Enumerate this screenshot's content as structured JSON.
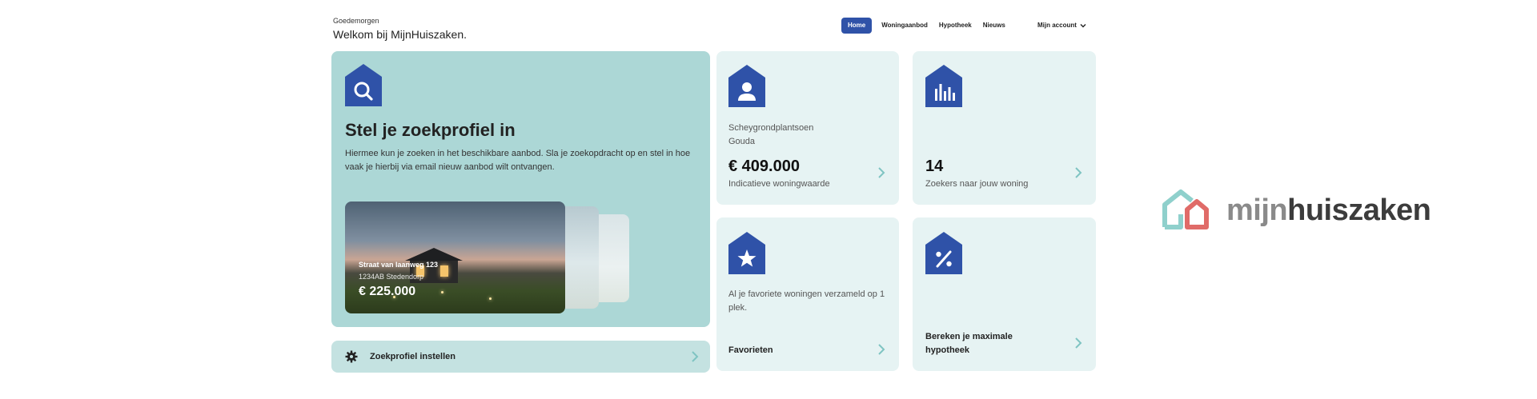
{
  "header": {
    "greeting_small": "Goedemorgen",
    "greeting_big": "Welkom bij MijnHuiszaken."
  },
  "nav": {
    "items": [
      {
        "label": "Home",
        "active": true
      },
      {
        "label": "Woningaanbod",
        "active": false
      },
      {
        "label": "Hypotheek",
        "active": false
      },
      {
        "label": "Nieuws",
        "active": false
      }
    ],
    "account_label": "Mijn account"
  },
  "hero": {
    "icon": "search-icon",
    "title": "Stel je zoekprofiel in",
    "description": "Hiermee kun je zoeken in het beschikbare aanbod. Sla je zoekopdracht op en stel in hoe vaak je hierbij via email nieuw aanbod wilt ontvangen.",
    "listing": {
      "street": "Straat van laanweg 123",
      "zip_city": "1234AB Stedendorp",
      "price": "€ 225.000"
    }
  },
  "profile_bar": {
    "icon": "gear-icon",
    "label": "Zoekprofiel instellen"
  },
  "cards": {
    "value": {
      "icon": "person-icon",
      "street": "Scheygrondplantsoen",
      "city": "Gouda",
      "amount": "€ 409.000",
      "caption": "Indicatieve woningwaarde"
    },
    "seekers": {
      "icon": "bar-chart-icon",
      "count": "14",
      "caption": "Zoekers naar jouw woning"
    },
    "favorites": {
      "icon": "star-icon",
      "description": "Al je favoriete woningen verzameld op 1 plek.",
      "label": "Favorieten"
    },
    "mortgage": {
      "icon": "percent-icon",
      "label": "Bereken je maximale hypotheek"
    }
  },
  "logo": {
    "part1": "mijn",
    "part2": "huiszaken"
  },
  "colors": {
    "accent": "#2f52a8",
    "teal": "#acd7d6",
    "light_card": "#e6f3f3",
    "chevron": "#7fc4c2"
  }
}
